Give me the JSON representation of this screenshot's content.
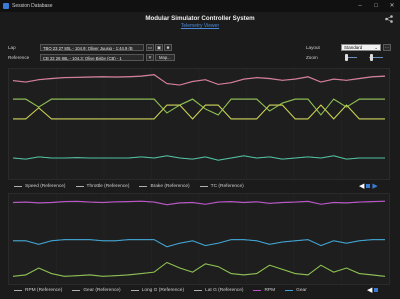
{
  "window": {
    "title": "Session Database",
    "minimize": "–",
    "maximize": "□",
    "close": "✕"
  },
  "header": {
    "title": "Modular Simulator Controller System",
    "subtitle": "Telemetry Viewer",
    "share_icon": "share-icon"
  },
  "controls": {
    "lap_label": "Lap",
    "lap_value": "TBO 23 27 80L - 104.9: Oliver Juusig - 1:44.9 (B",
    "reference_label": "Reference",
    "reference_value": "CB 22 26 86L - 104.3: Olive Bisby (CB) - 1",
    "map_label": "Map...",
    "layout_label": "Layout",
    "layout_value": "Standard",
    "zoom_label": "Zoom",
    "zoom_level_1": 0.05,
    "zoom_level_2": 0.1
  },
  "legend_top": {
    "items": [
      {
        "label": "Speed (Reference)",
        "color": "#b0b0b0"
      },
      {
        "label": "Throttle (Reference)",
        "color": "#b0b0b0"
      },
      {
        "label": "Brake (Reference)",
        "color": "#b0b0b0"
      },
      {
        "label": "TC (Reference)",
        "color": "#b0b0b0"
      }
    ]
  },
  "legend_bottom": {
    "items": [
      {
        "label": "RPM (Reference)",
        "color": "#b0b0b0"
      },
      {
        "label": "Gear (Reference)",
        "color": "#b0b0b0"
      },
      {
        "label": "Long G (Reference)",
        "color": "#b0b0b0"
      },
      {
        "label": "Lat G (Reference)",
        "color": "#b0b0b0"
      },
      {
        "label": "RPM",
        "color": "#c04fd0"
      },
      {
        "label": "Gear",
        "color": "#3aa6d8"
      }
    ]
  },
  "pager": {
    "prev": "◀",
    "next": "▶"
  },
  "colors": {
    "speed": "#e07aa0",
    "throttle": "#8bc34a",
    "brake": "#d8486a",
    "tc": "#c9d24a",
    "rpm": "#c04fd0",
    "gear": "#3aa6d8",
    "longg": "#8bc34a",
    "latg": "#4fc3a1",
    "reference": "#8a8a8a"
  },
  "chart_data": [
    {
      "type": "line",
      "series": [
        {
          "name": "Speed",
          "values": [
            0.75,
            0.7,
            0.78,
            0.82,
            0.85,
            0.86,
            0.87,
            0.88,
            0.87,
            0.88,
            0.9,
            0.95,
            0.65,
            0.6,
            0.72,
            0.78,
            0.62,
            0.68,
            0.8,
            0.85,
            0.82,
            0.76,
            0.8,
            0.88,
            0.7,
            0.8,
            0.76,
            0.82,
            0.88,
            0.9
          ]
        },
        {
          "name": "Throttle",
          "values": [
            1,
            1,
            0.6,
            1,
            1,
            1,
            1,
            1,
            1,
            1,
            1,
            1,
            0.3,
            0.7,
            1,
            0.5,
            0.2,
            1,
            1,
            1,
            0.4,
            0.8,
            1,
            1,
            0.2,
            1,
            0.6,
            1,
            1,
            1
          ]
        },
        {
          "name": "TC",
          "values": [
            0,
            0,
            0.8,
            0,
            0,
            0,
            0,
            0,
            0,
            0,
            0,
            0,
            1,
            1,
            0,
            1,
            1,
            0,
            0,
            0,
            1,
            1,
            0,
            0,
            1,
            0,
            1,
            0,
            0,
            0
          ]
        },
        {
          "name": "Gear",
          "values": [
            0.5,
            0.45,
            0.55,
            0.5,
            0.5,
            0.52,
            0.5,
            0.5,
            0.5,
            0.5,
            0.55,
            0.5,
            0.6,
            0.5,
            0.45,
            0.55,
            0.4,
            0.5,
            0.6,
            0.5,
            0.55,
            0.45,
            0.5,
            0.55,
            0.5,
            0.6,
            0.45,
            0.5,
            0.5,
            0.5
          ]
        }
      ]
    },
    {
      "type": "line",
      "series": [
        {
          "name": "RPM",
          "values": [
            0.8,
            0.82,
            0.78,
            0.8,
            0.84,
            0.85,
            0.82,
            0.8,
            0.83,
            0.84,
            0.86,
            0.82,
            0.7,
            0.78,
            0.8,
            0.72,
            0.82,
            0.84,
            0.8,
            0.83,
            0.76,
            0.8,
            0.82,
            0.85,
            0.72,
            0.8,
            0.78,
            0.82,
            0.84,
            0.86
          ]
        },
        {
          "name": "Gear",
          "values": [
            0.55,
            0.55,
            0.4,
            0.55,
            0.6,
            0.6,
            0.6,
            0.55,
            0.55,
            0.6,
            0.6,
            0.6,
            0.3,
            0.45,
            0.55,
            0.35,
            0.45,
            0.6,
            0.6,
            0.55,
            0.4,
            0.5,
            0.55,
            0.6,
            0.35,
            0.55,
            0.45,
            0.55,
            0.6,
            0.6
          ]
        },
        {
          "name": "Long G",
          "values": [
            0.2,
            0.25,
            0.5,
            0.3,
            0.2,
            0.22,
            0.25,
            0.2,
            0.22,
            0.25,
            0.3,
            0.35,
            0.7,
            0.5,
            0.35,
            0.65,
            0.55,
            0.3,
            0.25,
            0.3,
            0.6,
            0.45,
            0.3,
            0.25,
            0.6,
            0.35,
            0.5,
            0.3,
            0.25,
            0.2
          ]
        }
      ]
    }
  ]
}
